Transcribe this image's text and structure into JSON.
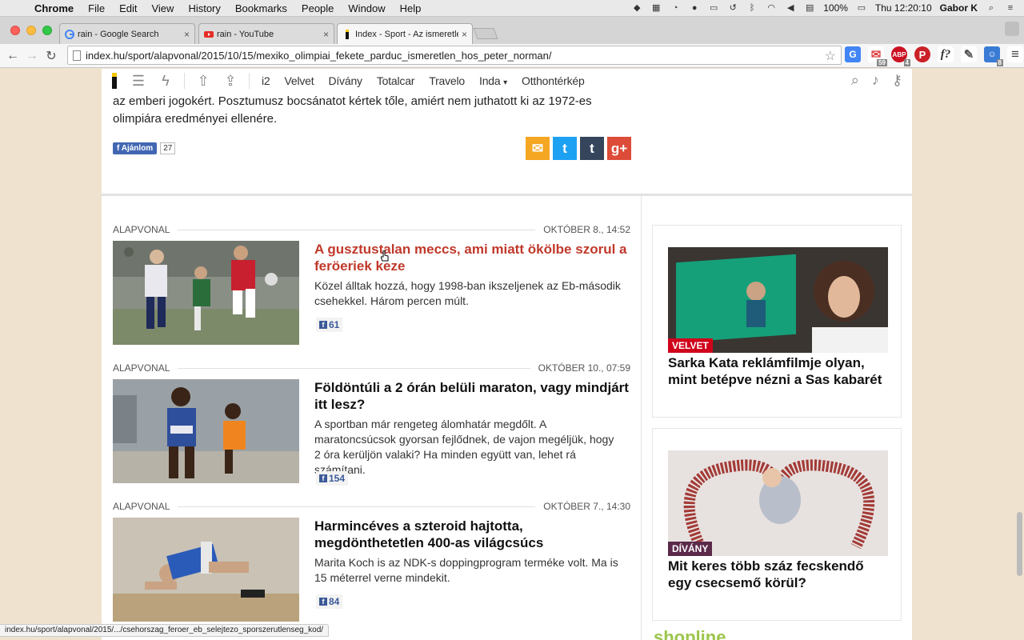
{
  "menubar": {
    "app": "Chrome",
    "items": [
      "File",
      "Edit",
      "View",
      "History",
      "Bookmarks",
      "People",
      "Window",
      "Help"
    ],
    "battery": "100%",
    "clock": "Thu 12:20:10",
    "user": "Gabor K"
  },
  "tabs": [
    {
      "title": "rain - Google Search",
      "favicon": "google-icon"
    },
    {
      "title": "rain - YouTube",
      "favicon": "youtube-icon"
    },
    {
      "title": "Index - Sport - Az ismeretlen",
      "favicon": "index-icon",
      "active": true
    }
  ],
  "omnibox": {
    "url": "index.hu/sport/alapvonal/2015/10/15/mexiko_olimpiai_fekete_parduc_ismeretlen_hos_peter_norman/"
  },
  "extensions": {
    "gmail_badge": "59",
    "adblock_badge": "4",
    "misc_badge": "8"
  },
  "sitenav": {
    "links": [
      "i2",
      "Velvet",
      "Dívány",
      "Totalcar",
      "Travelo",
      "Inda",
      "Otthontérkép"
    ],
    "inda_caret": "▾"
  },
  "lead": {
    "text": "az emberi jogokért. Posztumusz bocsánatot kértek tőle, amiért nem juthatott ki az 1972-es olimpiára eredményei ellenére.",
    "like_label": "Ajánlom",
    "like_count": "27"
  },
  "articles": [
    {
      "section": "ALAPVONAL",
      "date": "OKTÓBER 8., 14:52",
      "title": "A gusztustalan meccs, ami miatt ökölbe szorul a feröeriek keze",
      "lede": "Közel álltak hozzá, hogy 1998-ban ikszeljenek az Eb-második csehekkel. Három percen múlt.",
      "fb": "61"
    },
    {
      "section": "ALAPVONAL",
      "date": "OKTÓBER 10., 07:59",
      "title": "Földöntúli a 2 órán belüli maraton, vagy mindjárt itt lesz?",
      "lede": "A sportban már rengeteg álomhatár megdőlt. A maratoncsúcsok gyorsan fejlődnek, de vajon megéljük, hogy 2 óra kerüljön valaki? Ha minden együtt van, lehet rá számítani.",
      "fb": "154"
    },
    {
      "section": "ALAPVONAL",
      "date": "OKTÓBER 7., 14:30",
      "title": "Harmincéves a szteroid hajtotta, megdönthetetlen 400-as világcsúcs",
      "lede": "Marita Koch is az NDK-s doppingprogram terméke volt. Ma is 15 méterrel verne mindekit.",
      "fb": "84"
    }
  ],
  "sidebar": [
    {
      "tag": "VELVET",
      "tag_color": "#d0021b",
      "title": "Sarka Kata reklámfilmje olyan, mint betépve nézni a Sas kabarét"
    },
    {
      "tag": "DÍVÁNY",
      "tag_color": "#5b2a4a",
      "title": "Mit keres több száz fecskendő egy csecsemő körül?"
    }
  ],
  "partner_text": "shopline",
  "status_url": "index.hu/sport/alapvonal/2015/.../csehorszag_feroer_eb_selejtezo_sporszerutlenseg_kod/"
}
